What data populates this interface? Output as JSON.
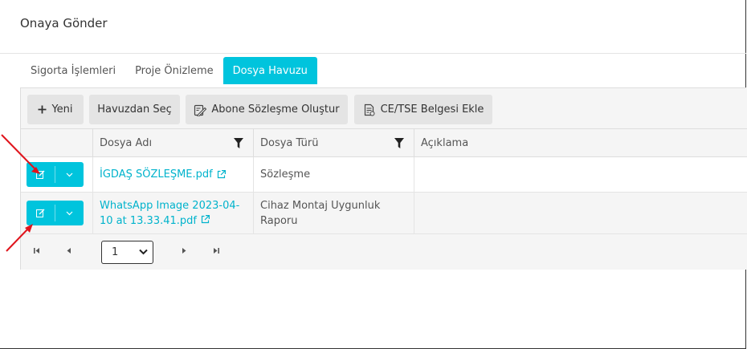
{
  "dialog": {
    "title": "Onaya Gönder"
  },
  "tabs": [
    {
      "label": "Sigorta İşlemleri"
    },
    {
      "label": "Proje Önizleme"
    },
    {
      "label": "Dosya Havuzu",
      "active": true
    }
  ],
  "toolbar": {
    "new_label": "Yeni",
    "pool_label": "Havuzdan Seç",
    "contract_label": "Abone Sözleşme Oluştur",
    "certificate_label": "CE/TSE Belgesi Ekle"
  },
  "table": {
    "columns": [
      "Dosya Adı",
      "Dosya Türü",
      "Açıklama"
    ],
    "rows": [
      {
        "file_name": "İGDAŞ SÖZLEŞME.pdf",
        "file_name_line2": "",
        "file_type": "Sözleşme",
        "file_type_line2": "",
        "description": ""
      },
      {
        "file_name": "WhatsApp Image 2023-04-",
        "file_name_line2": "10 at 13.33.41.pdf",
        "file_type": "Cihaz Montaj Uygunluk",
        "file_type_line2": "Raporu",
        "description": ""
      }
    ]
  },
  "pager": {
    "page": "1"
  },
  "colors": {
    "accent": "#00c4dd",
    "link": "#00b3cc",
    "annotation": "#e0141c"
  }
}
